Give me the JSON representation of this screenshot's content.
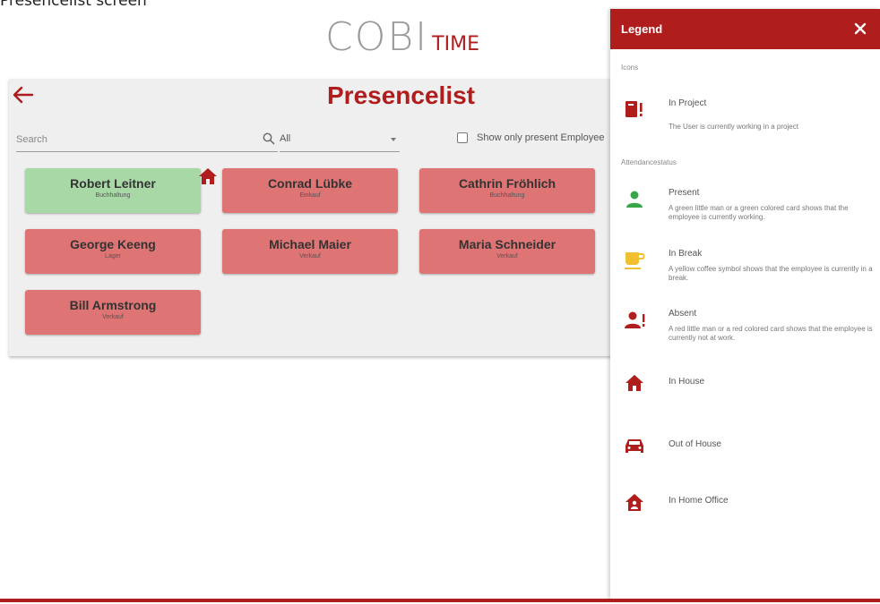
{
  "caption": "Presencelist screen",
  "brand": {
    "logo": "COBI",
    "logo_accent": "TIME"
  },
  "page": {
    "title": "Presencelist"
  },
  "toolbar": {
    "search_placeholder": "Search",
    "filter_value": "All",
    "checkbox_label": "Show only present Employee",
    "checkbox_checked": false
  },
  "employees": [
    {
      "name": "Robert Leitner",
      "department": "Buchhaltung",
      "status": "present",
      "location": "in-house"
    },
    {
      "name": "Conrad Lübke",
      "department": "Einkauf",
      "status": "absent"
    },
    {
      "name": "Cathrin Fröhlich",
      "department": "Buchhaltung",
      "status": "absent"
    },
    {
      "name": "George Keeng",
      "department": "Lager",
      "status": "absent"
    },
    {
      "name": "Michael Maier",
      "department": "Verkauf",
      "status": "absent"
    },
    {
      "name": "Maria Schneider",
      "department": "Verkauf",
      "status": "absent"
    },
    {
      "name": "Bill Armstrong",
      "department": "Verkauf",
      "status": "absent"
    }
  ],
  "legend": {
    "title": "Legend",
    "close_icon": "close-icon",
    "sections": {
      "icons": "Icons",
      "attendance": "Attendancestatus"
    },
    "items": [
      {
        "icon": "in-project-icon",
        "title": "In Project",
        "description": "The User is currently working in a project"
      },
      {
        "icon": "present-person-icon",
        "title": "Present",
        "description": "A green little man or a green colored card shows that the employee is currently working."
      },
      {
        "icon": "coffee-cup-icon",
        "title": "In Break",
        "description": "A yellow coffee symbol shows that the employee is currently in a break."
      },
      {
        "icon": "absent-person-icon",
        "title": "Absent",
        "description": "A red little man or a red colored card shows that the employee is currently not at work."
      },
      {
        "icon": "house-icon",
        "title": "In House",
        "description": ""
      },
      {
        "icon": "car-icon",
        "title": "Out of House",
        "description": ""
      },
      {
        "icon": "home-office-icon",
        "title": "In Home Office",
        "description": ""
      }
    ]
  },
  "colors": {
    "accent": "#b01d1d",
    "present_card": "#a8d8a5",
    "absent_card": "#df7474",
    "present_icon": "#3aa64a",
    "break_icon": "#f0c030"
  }
}
